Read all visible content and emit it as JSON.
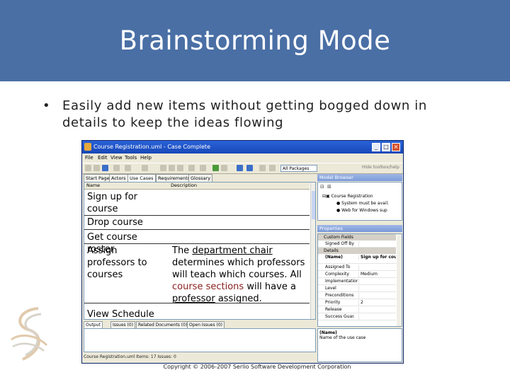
{
  "slide": {
    "title": "Brainstorming Mode",
    "bullet_symbol": "•",
    "bullet_text": "Easily add new items without getting bogged down in details to keep the ideas flowing",
    "copyright": "Copyright © 2006-2007 Serlio Software Development Corporation",
    "band_color": "#4a6fa5"
  },
  "window": {
    "title": "Course Registration.uml - Case Complete",
    "menu": [
      "File",
      "Edit",
      "View",
      "Tools",
      "Help"
    ],
    "package_combo": "All Packages",
    "toolbox_label": "Hide toolbox/help",
    "tabs": [
      "Start Page",
      "Actors",
      "Use Cases",
      "Requirements",
      "Glossary"
    ],
    "grid": {
      "headers": [
        "Name",
        "Description"
      ],
      "rows": [
        {
          "name": "Sign up for course",
          "desc": ""
        },
        {
          "name": "Drop course",
          "desc": ""
        },
        {
          "name": "Get course roster",
          "desc": ""
        },
        {
          "name": "Assign professors to courses",
          "desc_1": "The ",
          "desc_link1": "department chair",
          "desc_2": " determines which professors will teach which courses. All ",
          "desc_red": "course sections",
          "desc_3": " will have a ",
          "desc_link2": "professor",
          "desc_4": " assigned."
        },
        {
          "name": "View Schedule",
          "desc": ""
        }
      ]
    },
    "model_browser": {
      "header": "Model Browser",
      "items": [
        "Course Registration",
        "System must be avail.",
        "Web for Windows sup"
      ]
    },
    "properties": {
      "header": "Properties",
      "category": "Custom Fields",
      "rows": [
        {
          "k": "Signed Off By",
          "v": ""
        },
        {
          "k": "Details",
          "v": ""
        },
        {
          "k": "(Name)",
          "v": "Sign up for cou",
          "bold": true
        },
        {
          "k": "Assigned To",
          "v": ""
        },
        {
          "k": "Complexity",
          "v": "Medium"
        },
        {
          "k": "Implementation",
          "v": ""
        },
        {
          "k": "Level",
          "v": ""
        },
        {
          "k": "Preconditions",
          "v": ""
        },
        {
          "k": "Priority",
          "v": "2"
        },
        {
          "k": "Release",
          "v": ""
        },
        {
          "k": "Success Guar.",
          "v": ""
        }
      ],
      "desc_title": "(Name)",
      "desc_text": "Name of the use case"
    },
    "bottom_tabs": [
      "Output",
      "Issues (0)",
      "Related Documents (0)",
      "Open Issues (0)"
    ],
    "status": "Course Registration.uml  Items: 17  Issues: 0"
  }
}
